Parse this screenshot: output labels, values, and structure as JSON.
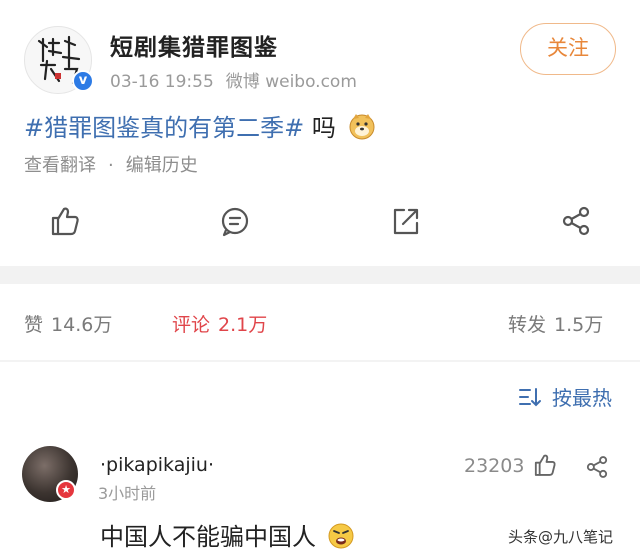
{
  "post": {
    "account_name": "短剧集猎罪图鉴",
    "time": "03-16 19:55",
    "source": "微博 weibo.com",
    "follow_label": "关注",
    "hashtag": "#猎罪图鉴真的有第二季#",
    "text_suffix": " 吗",
    "links": {
      "translate": "查看翻译",
      "separator": "·",
      "edit_history": "编辑历史"
    },
    "actions": [
      "like-icon",
      "comment-icon",
      "repost-icon",
      "share-icon"
    ]
  },
  "stats": {
    "likes_label": "赞",
    "likes_count": "14.6万",
    "comments_label": "评论",
    "comments_count": "2.1万",
    "reposts_label": "转发",
    "reposts_count": "1.5万"
  },
  "sort": {
    "label": "按最热",
    "icon": "sort-icon"
  },
  "comment": {
    "username": "·pikapikajiu·",
    "time": "3小时前",
    "likes": "23203",
    "text": "中国人不能骗中国人"
  },
  "watermark": "头条@九八笔记",
  "colors": {
    "link_blue": "#3f6fb0",
    "follow_orange": "#e8873a",
    "active_red": "#e0454a",
    "verified_blue": "#2d7be5"
  }
}
